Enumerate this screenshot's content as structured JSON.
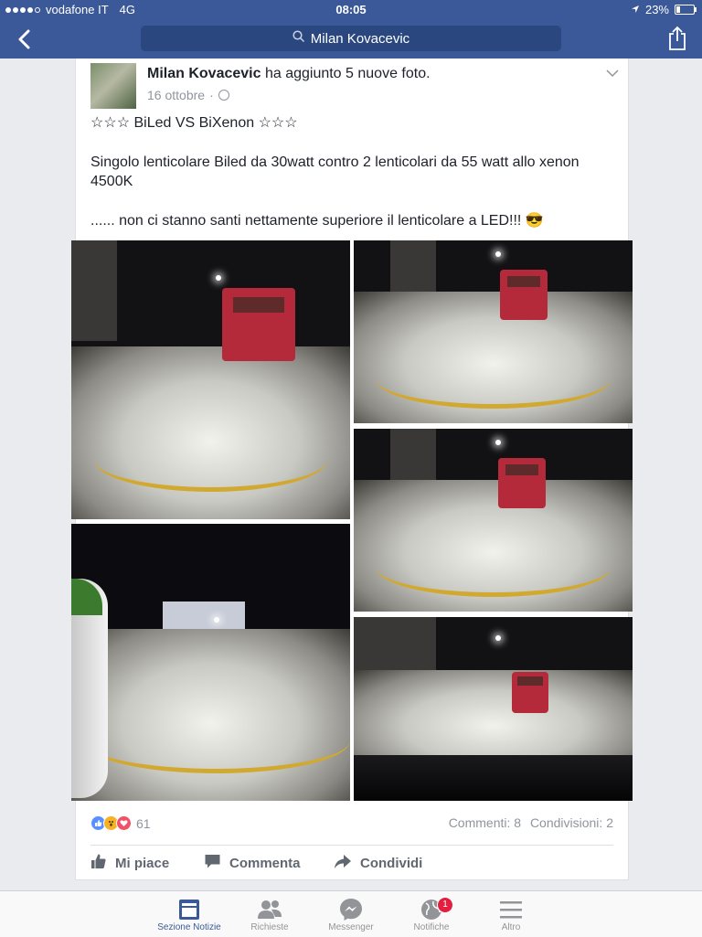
{
  "status_bar": {
    "carrier": "vodafone IT",
    "network": "4G",
    "time": "08:05",
    "battery": "23%",
    "battery_level": 0.23
  },
  "nav": {
    "search_text": "Milan Kovacevic",
    "icons": [
      "back-chevron-icon",
      "search-icon",
      "share-icon"
    ]
  },
  "post": {
    "author": "Milan Kovacevic",
    "action": " ha aggiunto 5 nuove foto.",
    "date": "16 ottobre",
    "date_separator": "·",
    "title_line": "☆☆☆  BiLed   VS    BiXenon ☆☆☆",
    "text_line_1": "Singolo lenticolare Biled da 30watt contro 2 lenticolari  da 55 watt allo xenon 4500K",
    "text_line_2": "...... non ci stanno santi nettamente  superiore il lenticolare a LED!!! 😎",
    "reaction_count": "61",
    "comments": "Commenti: 8",
    "shares": "Condivisioni: 2"
  },
  "actions": {
    "like": "Mi piace",
    "comment": "Commenta",
    "share": "Condividi"
  },
  "tabbar": {
    "tab1": "Sezione Notizie",
    "tab2": "Richieste",
    "tab3": "Messenger",
    "tab4": "Notifiche",
    "tab5": "Altro",
    "notif_badge": "1"
  },
  "colors": {
    "brand": "#3b5998",
    "background": "#e9ebee",
    "badge": "#e41e3f"
  }
}
